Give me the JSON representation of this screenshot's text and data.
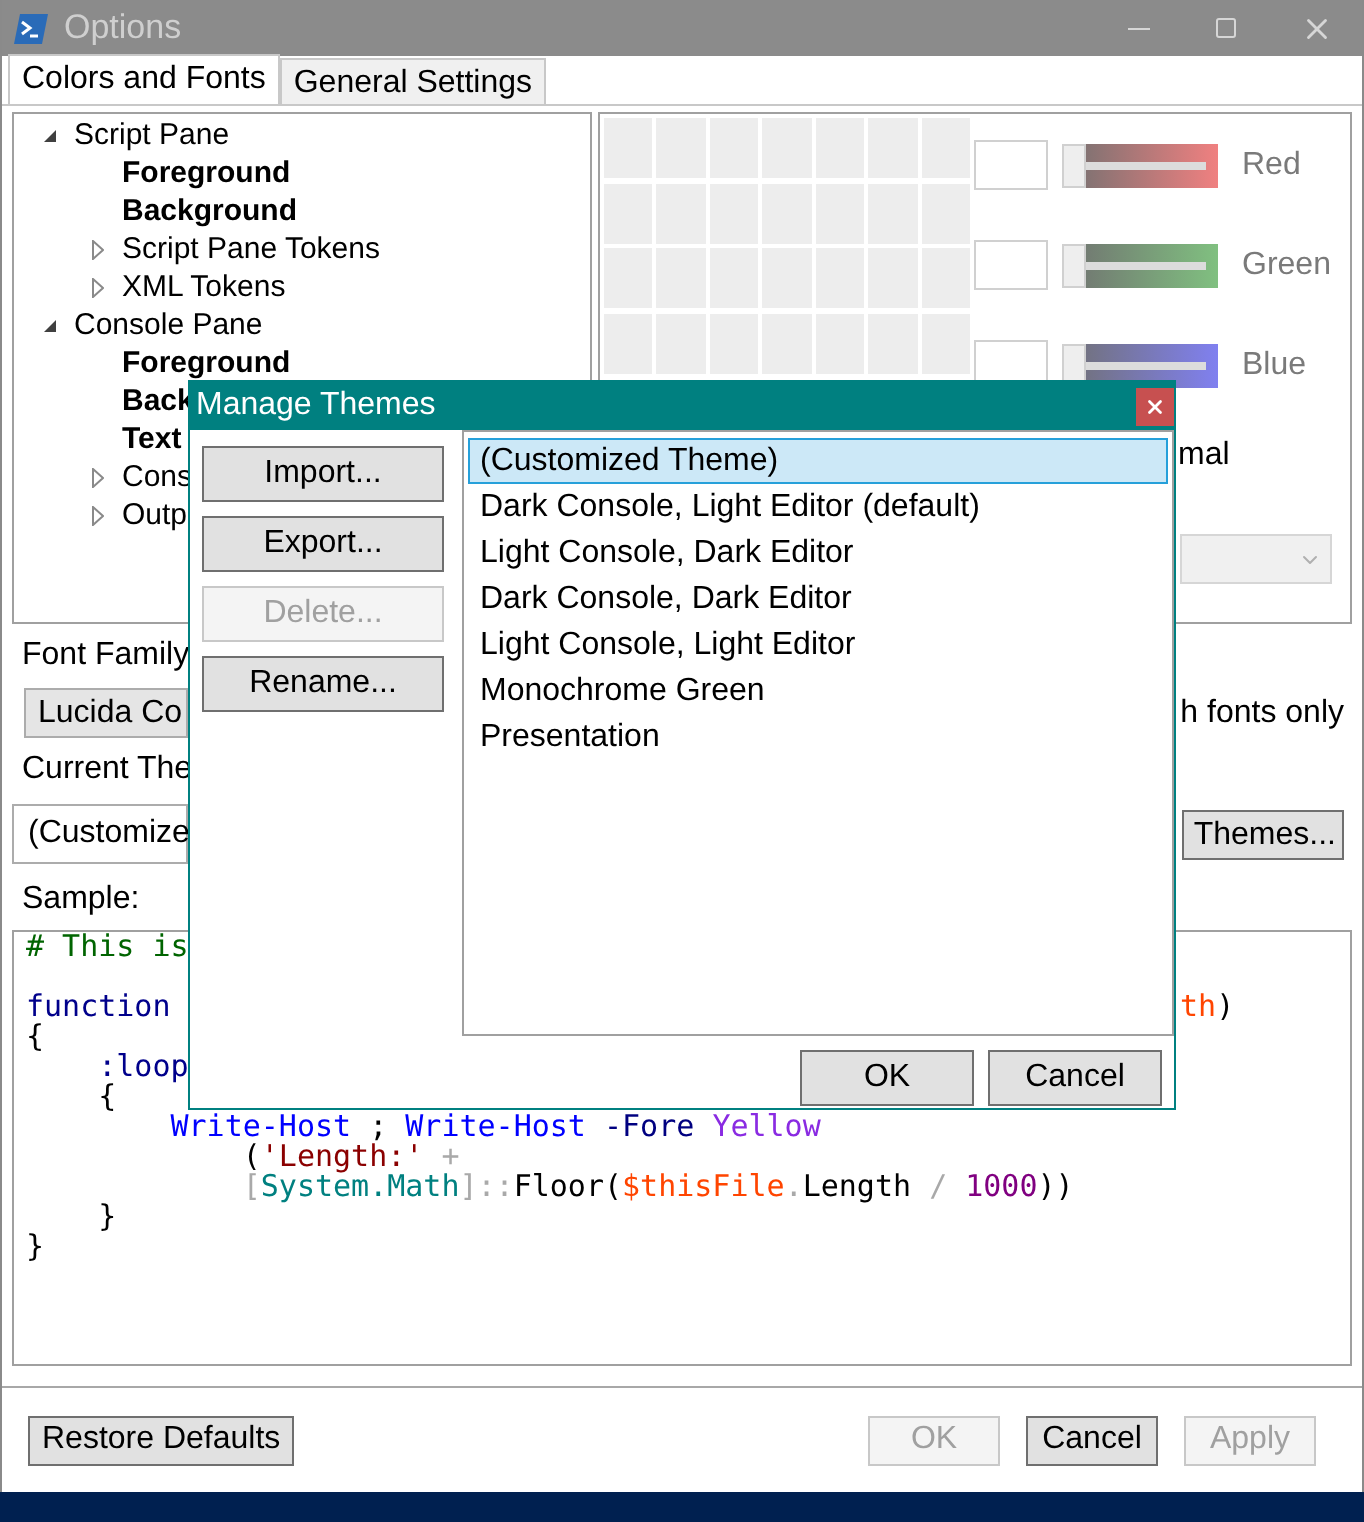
{
  "window": {
    "title": "Options"
  },
  "tabs": [
    {
      "label": "Colors and Fonts",
      "selected": true
    },
    {
      "label": "General Settings",
      "selected": false
    }
  ],
  "tree": [
    {
      "label": "Script Pane",
      "kind": "category",
      "expanded": true,
      "children": [
        {
          "label": "Foreground",
          "kind": "color"
        },
        {
          "label": "Background",
          "kind": "color"
        },
        {
          "label": "Script Pane Tokens",
          "kind": "category",
          "expanded": false
        },
        {
          "label": "XML Tokens",
          "kind": "category",
          "expanded": false
        }
      ]
    },
    {
      "label": "Console Pane",
      "kind": "category",
      "expanded": true,
      "children": [
        {
          "label": "Foreground",
          "kind": "color"
        },
        {
          "label": "Back",
          "kind": "color"
        },
        {
          "label": "Text",
          "kind": "color"
        },
        {
          "label": "Cons",
          "kind": "category",
          "expanded": false
        },
        {
          "label": "Outp",
          "kind": "category",
          "expanded": false
        }
      ]
    }
  ],
  "color_sliders": [
    {
      "label": "Red",
      "color": "#f08080",
      "level": 0
    },
    {
      "label": "Green",
      "color": "#80c080",
      "level": 0
    },
    {
      "label": "Blue",
      "color": "#8080f0",
      "level": 0
    }
  ],
  "style_option": {
    "label": "mal"
  },
  "style_dropdown": {
    "disabled": true
  },
  "font_family": {
    "label": "Font Family",
    "value": "Lucida Co",
    "option_label": "h fonts only"
  },
  "current_theme": {
    "label": "Current The",
    "value": "(Customize",
    "manage_button": "Themes..."
  },
  "sample": {
    "label": "Sample:",
    "lines": [
      {
        "segments": [
          {
            "text": "# This is",
            "color": "#006400"
          }
        ]
      },
      {
        "blank_before": true,
        "segments": [
          {
            "text": "function",
            "color": "#00008b"
          }
        ],
        "right_segments": [
          {
            "text": "th",
            "color": "#ff4500"
          },
          {
            "text": ")",
            "color": "#000000"
          }
        ]
      },
      {
        "segments": [
          {
            "text": "{",
            "color": "#000000"
          }
        ]
      },
      {
        "segments": [
          {
            "text": "    :loop",
            "color": "#00008b"
          }
        ]
      },
      {
        "segments": [
          {
            "text": "    {",
            "color": "#000000"
          }
        ]
      },
      {
        "segments": [
          {
            "text": "        Write-Host",
            "color": "#0000ff"
          },
          {
            "text": " ; ",
            "color": "#000000"
          },
          {
            "text": "Write-Host",
            "color": "#0000ff"
          },
          {
            "text": " -Fore ",
            "color": "#000080"
          },
          {
            "text": "Yellow",
            "color": "#8a2be2"
          }
        ]
      },
      {
        "segments": [
          {
            "text": "            (",
            "color": "#000000"
          },
          {
            "text": "'Length:'",
            "color": "#8b0000"
          },
          {
            "text": " +",
            "color": "#a9a9a9"
          }
        ]
      },
      {
        "segments": [
          {
            "text": "            [",
            "color": "#a9a9a9"
          },
          {
            "text": "System.Math",
            "color": "#008080"
          },
          {
            "text": "]::",
            "color": "#a9a9a9"
          },
          {
            "text": "Floor(",
            "color": "#000000"
          },
          {
            "text": "$thisFile",
            "color": "#ff4500"
          },
          {
            "text": ".",
            "color": "#a9a9a9"
          },
          {
            "text": "Length ",
            "color": "#000000"
          },
          {
            "text": "/",
            "color": "#a9a9a9"
          },
          {
            "text": " 1000",
            "color": "#800080"
          },
          {
            "text": "))",
            "color": "#000000"
          }
        ]
      },
      {
        "segments": [
          {
            "text": "    }",
            "color": "#000000"
          }
        ]
      },
      {
        "segments": [
          {
            "text": "}",
            "color": "#000000"
          }
        ]
      }
    ]
  },
  "footer": {
    "restore": {
      "label": "Restore Defaults",
      "disabled": false
    },
    "actions": [
      {
        "label": "OK",
        "disabled": true
      },
      {
        "label": "Cancel",
        "disabled": false
      },
      {
        "label": "Apply",
        "disabled": true
      }
    ]
  },
  "dialog": {
    "title": "Manage Themes",
    "actions": [
      {
        "label": "Import...",
        "disabled": false
      },
      {
        "label": "Export...",
        "disabled": false
      },
      {
        "label": "Delete...",
        "disabled": true
      },
      {
        "label": "Rename...",
        "disabled": false
      }
    ],
    "themes": [
      {
        "label": "(Customized Theme)",
        "selected": true
      },
      {
        "label": "Dark Console, Light Editor (default)",
        "selected": false
      },
      {
        "label": "Light Console, Dark Editor",
        "selected": false
      },
      {
        "label": "Dark Console, Dark Editor",
        "selected": false
      },
      {
        "label": "Light Console, Light Editor",
        "selected": false
      },
      {
        "label": "Monochrome Green",
        "selected": false
      },
      {
        "label": "Presentation",
        "selected": false
      }
    ],
    "buttons": [
      "OK",
      "Cancel"
    ]
  }
}
